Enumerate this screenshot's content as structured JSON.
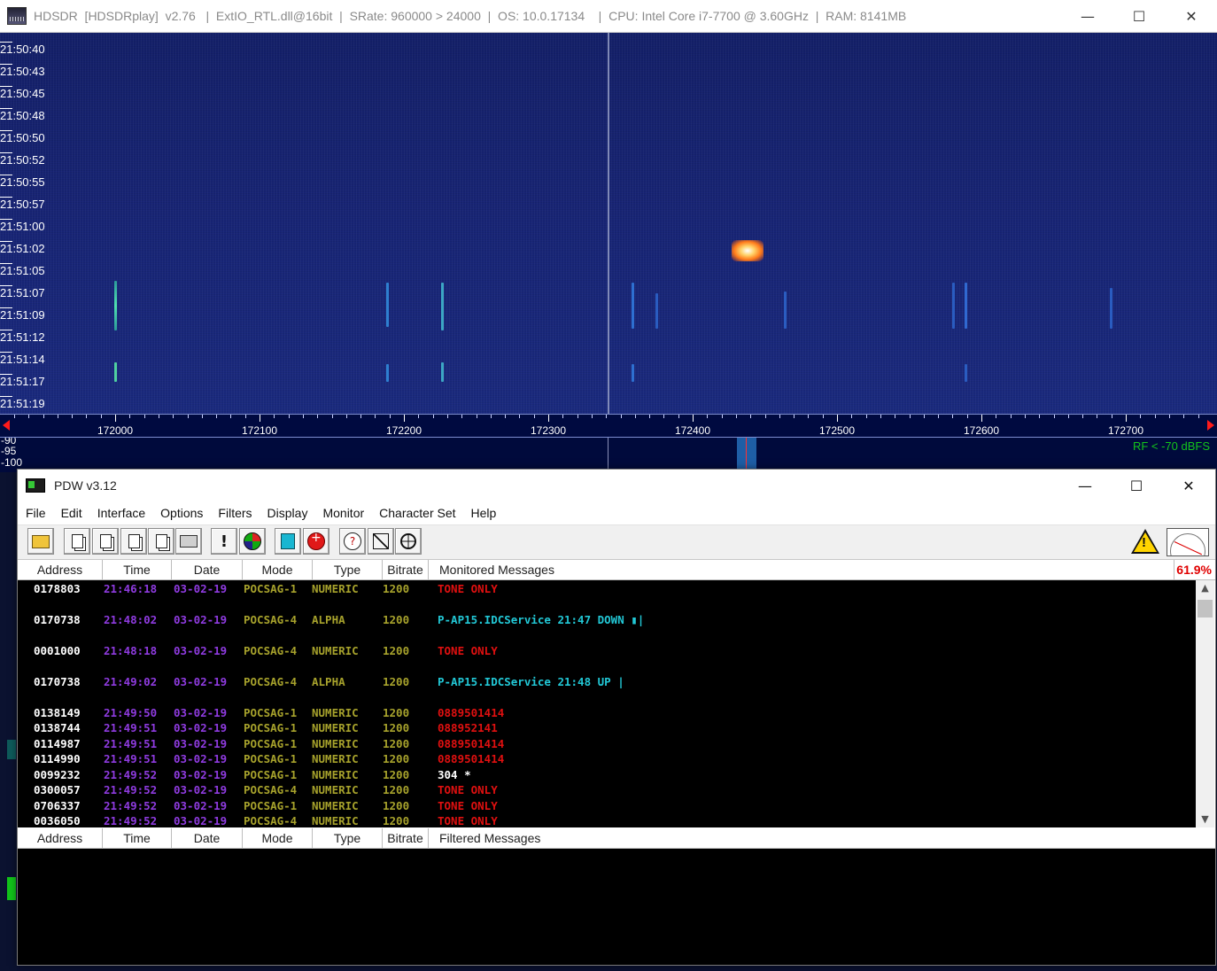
{
  "hdsdr": {
    "title": "HDSDR  [HDSDRplay]  v2.76   |  ExtIO_RTL.dll@16bit  |  SRate: 960000 > 24000  |  OS: 10.0.17134    |  CPU: Intel Core i7-7700 @ 3.60GHz  |  RAM: 8141MB",
    "controls": {
      "minimize": "—",
      "maximize": "☐",
      "close": "✕"
    },
    "waterfall_times": [
      "21:50:40",
      "21:50:43",
      "21:50:45",
      "21:50:48",
      "21:50:50",
      "21:50:52",
      "21:50:55",
      "21:50:57",
      "21:51:00",
      "21:51:02",
      "21:51:05",
      "21:51:07",
      "21:51:09",
      "21:51:12",
      "21:51:14",
      "21:51:17",
      "21:51:19"
    ],
    "frequency_labels": [
      "172000",
      "172100",
      "172200",
      "172300",
      "172400",
      "172500",
      "172600",
      "172700"
    ],
    "db_labels": [
      "-90",
      "-95",
      "-100"
    ],
    "rf_status": "RF < -70 dBFS",
    "colors": {
      "waterfall_bg": "#182577",
      "hotspot": "#ff7a1a",
      "rf_text": "#13c41c"
    }
  },
  "pdw": {
    "title": "PDW v3.12",
    "controls": {
      "minimize": "—",
      "maximize": "☐",
      "close": "✕"
    },
    "menu": [
      "File",
      "Edit",
      "Interface",
      "Options",
      "Filters",
      "Display",
      "Monitor",
      "Character Set",
      "Help"
    ],
    "toolbar_icons": [
      "open-folder-icon",
      "copy-icon",
      "copy-all-icon",
      "paste-icon",
      "clipboard-icon",
      "print-icon",
      "alert-icon",
      "globe-icon",
      "calculator-icon",
      "record-icon",
      "help-icon",
      "clear-icon",
      "target-icon"
    ],
    "warning_icon": "warning-icon",
    "meter_icon": "signal-meter-icon",
    "monitored_header": {
      "address": "Address",
      "time": "Time",
      "date": "Date",
      "mode": "Mode",
      "type": "Type",
      "bitrate": "Bitrate",
      "messages": "Monitored Messages"
    },
    "cpu_percent": "61.9%",
    "filtered_header": {
      "address": "Address",
      "time": "Time",
      "date": "Date",
      "mode": "Mode",
      "type": "Type",
      "bitrate": "Bitrate",
      "messages": "Filtered Messages"
    },
    "messages": [
      {
        "address": "0178803",
        "time": "21:46:18",
        "date": "03-02-19",
        "mode": "POCSAG-1",
        "type": "NUMERIC",
        "bitrate": "1200",
        "text": "TONE ONLY",
        "color": "red"
      },
      {
        "address": "0170738",
        "time": "21:48:02",
        "date": "03-02-19",
        "mode": "POCSAG-4",
        "type": "ALPHA",
        "bitrate": "1200",
        "text": "P-AP15.IDCService 21:47 DOWN ▮|",
        "color": "cyan"
      },
      {
        "address": "0001000",
        "time": "21:48:18",
        "date": "03-02-19",
        "mode": "POCSAG-4",
        "type": "NUMERIC",
        "bitrate": "1200",
        "text": "TONE ONLY",
        "color": "red"
      },
      {
        "address": "0170738",
        "time": "21:49:02",
        "date": "03-02-19",
        "mode": "POCSAG-4",
        "type": "ALPHA",
        "bitrate": "1200",
        "text": "P-AP15.IDCService 21:48 UP |",
        "color": "cyan"
      },
      {
        "address": "0138149",
        "time": "21:49:50",
        "date": "03-02-19",
        "mode": "POCSAG-1",
        "type": "NUMERIC",
        "bitrate": "1200",
        "text": "0889501414",
        "color": "red"
      },
      {
        "address": "0138744",
        "time": "21:49:51",
        "date": "03-02-19",
        "mode": "POCSAG-1",
        "type": "NUMERIC",
        "bitrate": "1200",
        "text": "088952141",
        "color": "red"
      },
      {
        "address": "0114987",
        "time": "21:49:51",
        "date": "03-02-19",
        "mode": "POCSAG-1",
        "type": "NUMERIC",
        "bitrate": "1200",
        "text": "0889501414",
        "color": "red"
      },
      {
        "address": "0114990",
        "time": "21:49:51",
        "date": "03-02-19",
        "mode": "POCSAG-1",
        "type": "NUMERIC",
        "bitrate": "1200",
        "text": "0889501414",
        "color": "red"
      },
      {
        "address": "0099232",
        "time": "21:49:52",
        "date": "03-02-19",
        "mode": "POCSAG-1",
        "type": "NUMERIC",
        "bitrate": "1200",
        "text": "304 *",
        "color": "white"
      },
      {
        "address": "0300057",
        "time": "21:49:52",
        "date": "03-02-19",
        "mode": "POCSAG-4",
        "type": "NUMERIC",
        "bitrate": "1200",
        "text": "TONE ONLY",
        "color": "red"
      },
      {
        "address": "0706337",
        "time": "21:49:52",
        "date": "03-02-19",
        "mode": "POCSAG-1",
        "type": "NUMERIC",
        "bitrate": "1200",
        "text": "TONE ONLY",
        "color": "red"
      },
      {
        "address": "0036050",
        "time": "21:49:52",
        "date": "03-02-19",
        "mode": "POCSAG-4",
        "type": "NUMERIC",
        "bitrate": "1200",
        "text": "TONE ONLY",
        "color": "red"
      }
    ]
  }
}
